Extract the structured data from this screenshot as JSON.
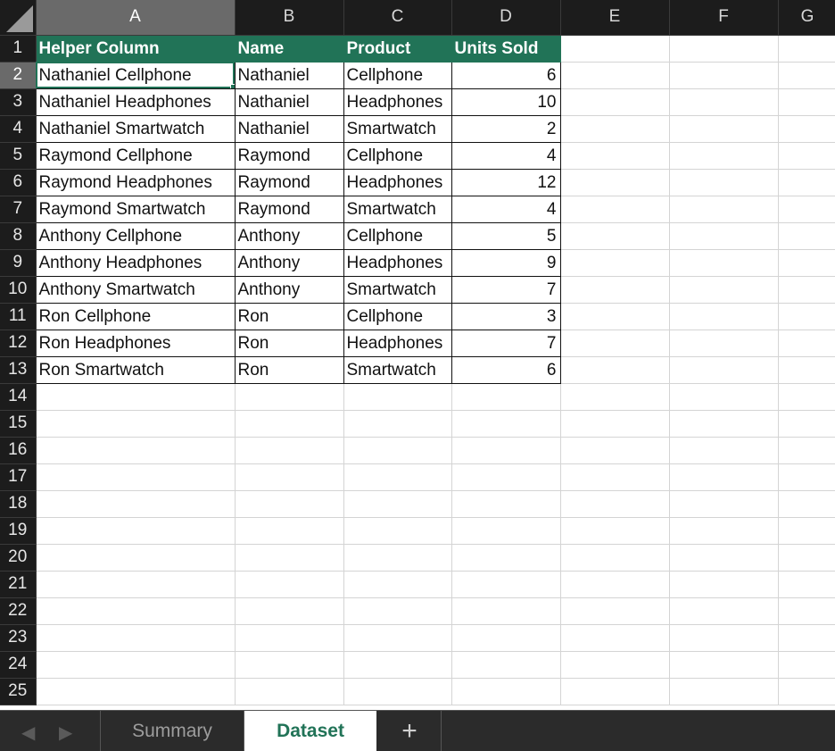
{
  "sheet": {
    "columns": [
      "A",
      "B",
      "C",
      "D",
      "E",
      "F",
      "G"
    ],
    "rows": [
      {
        "num": "1",
        "cells": [
          "Helper Column",
          "Name",
          "Product",
          "Units Sold",
          "",
          "",
          ""
        ]
      },
      {
        "num": "2",
        "cells": [
          "Nathaniel Cellphone",
          "Nathaniel",
          "Cellphone",
          "6",
          "",
          "",
          ""
        ]
      },
      {
        "num": "3",
        "cells": [
          "Nathaniel Headphones",
          "Nathaniel",
          "Headphones",
          "10",
          "",
          "",
          ""
        ]
      },
      {
        "num": "4",
        "cells": [
          "Nathaniel Smartwatch",
          "Nathaniel",
          "Smartwatch",
          "2",
          "",
          "",
          ""
        ]
      },
      {
        "num": "5",
        "cells": [
          "Raymond Cellphone",
          "Raymond",
          "Cellphone",
          "4",
          "",
          "",
          ""
        ]
      },
      {
        "num": "6",
        "cells": [
          "Raymond Headphones",
          "Raymond",
          "Headphones",
          "12",
          "",
          "",
          ""
        ]
      },
      {
        "num": "7",
        "cells": [
          "Raymond Smartwatch",
          "Raymond",
          "Smartwatch",
          "4",
          "",
          "",
          ""
        ]
      },
      {
        "num": "8",
        "cells": [
          "Anthony Cellphone",
          "Anthony",
          "Cellphone",
          "5",
          "",
          "",
          ""
        ]
      },
      {
        "num": "9",
        "cells": [
          "Anthony Headphones",
          "Anthony",
          "Headphones",
          "9",
          "",
          "",
          ""
        ]
      },
      {
        "num": "10",
        "cells": [
          "Anthony Smartwatch",
          "Anthony",
          "Smartwatch",
          "7",
          "",
          "",
          ""
        ]
      },
      {
        "num": "11",
        "cells": [
          "Ron Cellphone",
          "Ron",
          "Cellphone",
          "3",
          "",
          "",
          ""
        ]
      },
      {
        "num": "12",
        "cells": [
          "Ron Headphones",
          "Ron",
          "Headphones",
          "7",
          "",
          "",
          ""
        ]
      },
      {
        "num": "13",
        "cells": [
          "Ron Smartwatch",
          "Ron",
          "Smartwatch",
          "6",
          "",
          "",
          ""
        ]
      },
      {
        "num": "14",
        "cells": [
          "",
          "",
          "",
          "",
          "",
          "",
          ""
        ]
      },
      {
        "num": "15",
        "cells": [
          "",
          "",
          "",
          "",
          "",
          "",
          ""
        ]
      },
      {
        "num": "16",
        "cells": [
          "",
          "",
          "",
          "",
          "",
          "",
          ""
        ]
      },
      {
        "num": "17",
        "cells": [
          "",
          "",
          "",
          "",
          "",
          "",
          ""
        ]
      },
      {
        "num": "18",
        "cells": [
          "",
          "",
          "",
          "",
          "",
          "",
          ""
        ]
      },
      {
        "num": "19",
        "cells": [
          "",
          "",
          "",
          "",
          "",
          "",
          ""
        ]
      },
      {
        "num": "20",
        "cells": [
          "",
          "",
          "",
          "",
          "",
          "",
          ""
        ]
      },
      {
        "num": "21",
        "cells": [
          "",
          "",
          "",
          "",
          "",
          "",
          ""
        ]
      },
      {
        "num": "22",
        "cells": [
          "",
          "",
          "",
          "",
          "",
          "",
          ""
        ]
      },
      {
        "num": "23",
        "cells": [
          "",
          "",
          "",
          "",
          "",
          "",
          ""
        ]
      },
      {
        "num": "24",
        "cells": [
          "",
          "",
          "",
          "",
          "",
          "",
          ""
        ]
      },
      {
        "num": "25",
        "cells": [
          "",
          "",
          "",
          "",
          "",
          "",
          ""
        ]
      }
    ],
    "active_cell": "A2",
    "header_fill_color": "#217357"
  },
  "tabs": {
    "prev_icon": "◀",
    "next_icon": "▶",
    "items": [
      {
        "label": "Summary",
        "active": false
      },
      {
        "label": "Dataset",
        "active": true
      }
    ],
    "add_label": "+"
  }
}
